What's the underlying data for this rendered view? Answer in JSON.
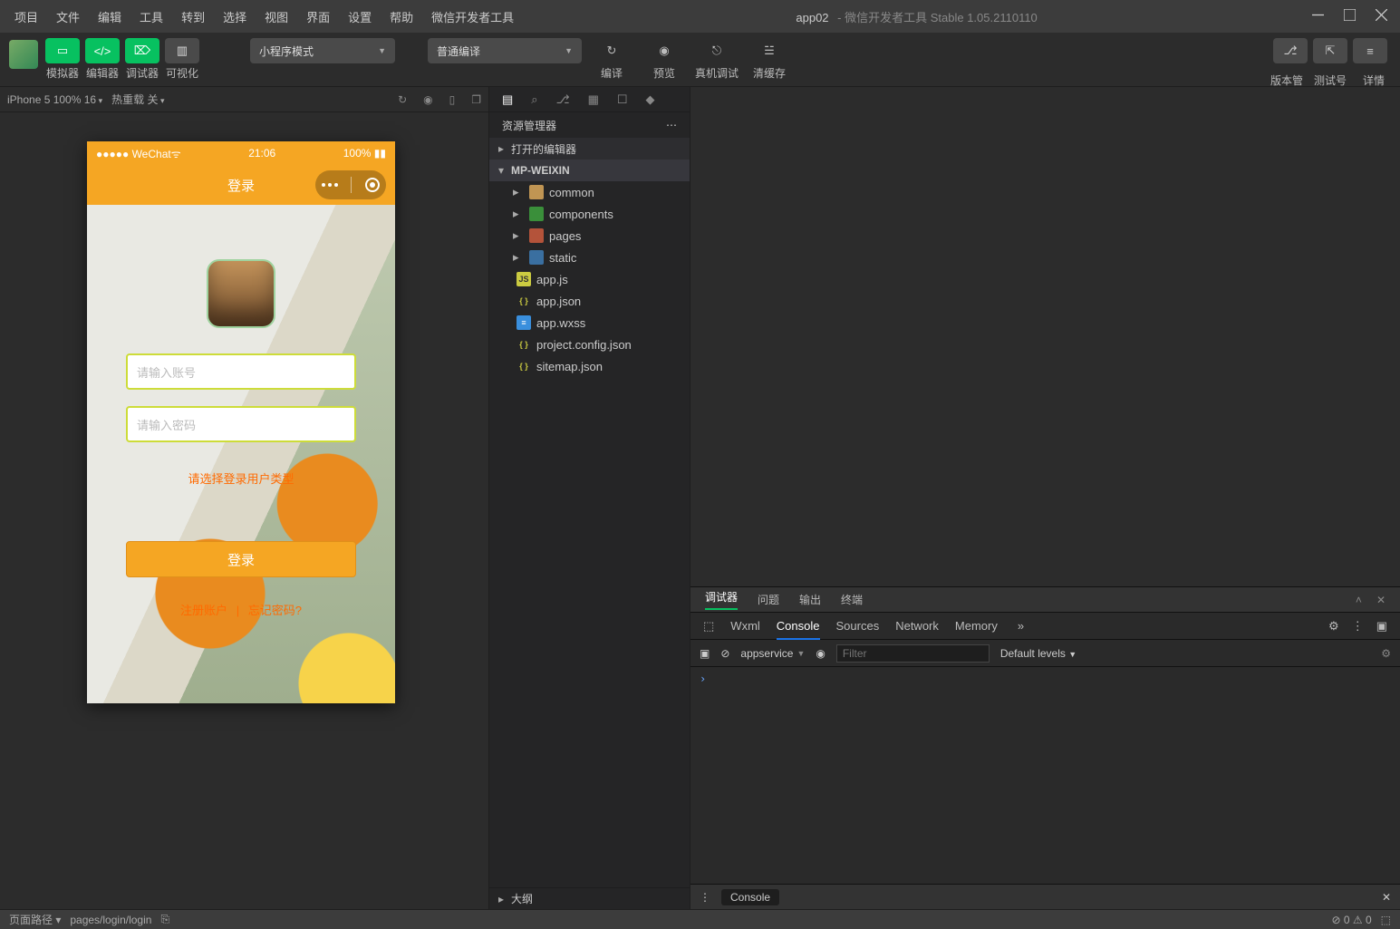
{
  "title": {
    "app": "app02",
    "suffix": "微信开发者工具 Stable 1.05.2110110"
  },
  "menu": [
    "项目",
    "文件",
    "编辑",
    "工具",
    "转到",
    "选择",
    "视图",
    "界面",
    "设置",
    "帮助",
    "微信开发者工具"
  ],
  "toolbar": {
    "tabs": [
      "模拟器",
      "编辑器",
      "调试器",
      "可视化"
    ],
    "modeCombo": "小程序模式",
    "compileCombo": "普通编译",
    "actions": [
      {
        "icon": "↻",
        "label": "编译"
      },
      {
        "icon": "◉",
        "label": "预览"
      },
      {
        "icon": "⎋",
        "label": "真机调试"
      },
      {
        "icon": "☰",
        "label": "清缓存"
      }
    ],
    "right": [
      {
        "icon": "⎇",
        "label": "版本管理"
      },
      {
        "icon": "⇱",
        "label": "测试号"
      },
      {
        "icon": "≡",
        "label": "详情"
      }
    ]
  },
  "sim": {
    "device": "iPhone 5 100% 16",
    "hotreload": "热重载 关",
    "status": {
      "carrier": "●●●●● WeChat",
      "wifi": "ᯤ",
      "time": "21:06",
      "battery": "100%"
    },
    "navTitle": "登录",
    "placeholders": {
      "user": "请输入账号",
      "pass": "请输入密码"
    },
    "hint": "请选择登录用户类型",
    "loginBtn": "登录",
    "links": {
      "reg": "注册账户",
      "forgot": "忘记密码?"
    }
  },
  "explorer": {
    "title": "资源管理器",
    "sections": {
      "open": "打开的编辑器",
      "project": "MP-WEIXIN",
      "outline": "大纲"
    },
    "tree": [
      {
        "kind": "folder",
        "name": "common",
        "cls": "folder"
      },
      {
        "kind": "folder",
        "name": "components",
        "cls": "folder-g"
      },
      {
        "kind": "folder",
        "name": "pages",
        "cls": "folder-r"
      },
      {
        "kind": "folder",
        "name": "static",
        "cls": "folder-b"
      },
      {
        "kind": "file",
        "name": "app.js",
        "cls": "js",
        "badge": "JS"
      },
      {
        "kind": "file",
        "name": "app.json",
        "cls": "json",
        "badge": "{ }"
      },
      {
        "kind": "file",
        "name": "app.wxss",
        "cls": "wxss",
        "badge": "≡"
      },
      {
        "kind": "file",
        "name": "project.config.json",
        "cls": "json",
        "badge": "{ }"
      },
      {
        "kind": "file",
        "name": "sitemap.json",
        "cls": "json",
        "badge": "{ }"
      }
    ]
  },
  "devtools": {
    "topTabs": [
      "调试器",
      "问题",
      "输出",
      "终端"
    ],
    "subTabs": [
      "Wxml",
      "Console",
      "Sources",
      "Network",
      "Memory"
    ],
    "activeSub": "Console",
    "context": "appservice",
    "filterPlaceholder": "Filter",
    "levels": "Default levels",
    "prompt": "›",
    "drawer": "Console"
  },
  "status": {
    "left": "页面路径 ▾",
    "path": "pages/login/login",
    "errs": "⊘ 0 ⚠ 0"
  }
}
